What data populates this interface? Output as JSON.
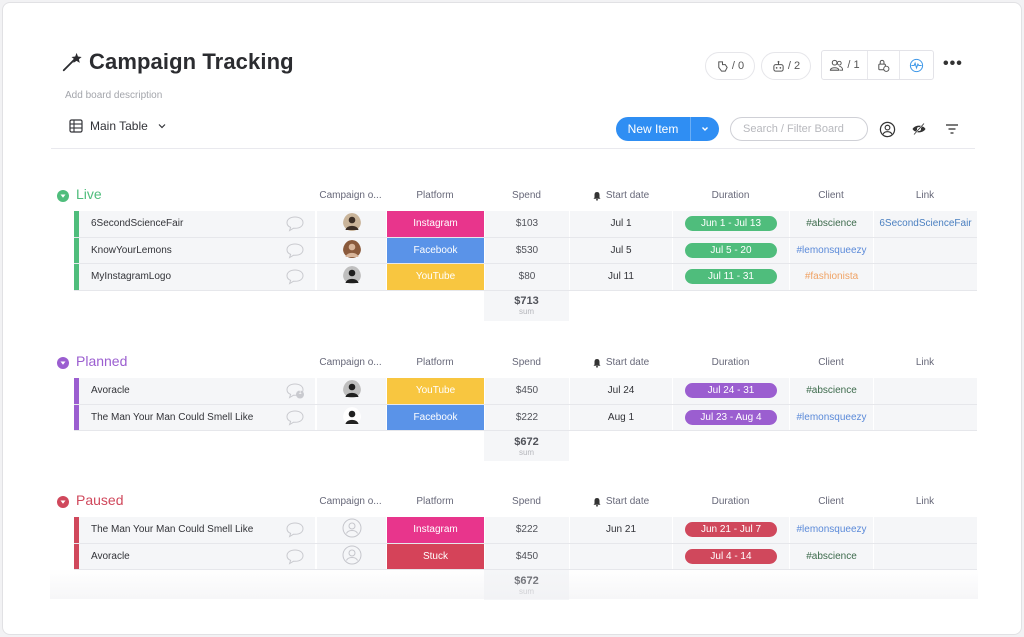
{
  "board": {
    "title": "Campaign Tracking",
    "description_placeholder": "Add board description",
    "view_name": "Main Table"
  },
  "header_tools": {
    "integrations_count": "/ 0",
    "automations_count": "/ 2",
    "members_count": "/ 1"
  },
  "toolbar": {
    "new_item_label": "New Item",
    "search_placeholder": "Search / Filter Board"
  },
  "columns": {
    "owner": "Campaign o...",
    "platform": "Platform",
    "spend": "Spend",
    "start": "Start date",
    "duration": "Duration",
    "client": "Client",
    "link": "Link"
  },
  "colors": {
    "accent": "#2f8ef3",
    "live": "#4fbd7c",
    "planned": "#9b5ed0",
    "paused": "#d0485c",
    "instagram": "#e8358c",
    "facebook": "#5a93e8",
    "youtube": "#f8c640",
    "stuck": "#d54359",
    "client_abscience": "#3d6b4c",
    "client_lemonsqueezy": "#5b8ad9",
    "client_fashionista": "#f0a365"
  },
  "groups": [
    {
      "name": "Live",
      "color": "#4fbd7c",
      "sum_value": "$713",
      "sum_label": "sum",
      "items": [
        {
          "name": "6SecondScienceFair",
          "comments": "",
          "owner": "pug",
          "platform": "Instagram",
          "platform_color": "#e8358c",
          "spend": "$103",
          "start": "Jul 1",
          "duration": "Jun 1 - Jul 13",
          "client": "#abscience",
          "client_color": "#3d6b4c",
          "link": "6SecondScienceFair"
        },
        {
          "name": "KnowYourLemons",
          "comments": "",
          "owner": "woman",
          "platform": "Facebook",
          "platform_color": "#5a93e8",
          "spend": "$530",
          "start": "Jul 5",
          "duration": "Jul 5 - 20",
          "client": "#lemonsqueezy",
          "client_color": "#5b8ad9",
          "link": ""
        },
        {
          "name": "MyInstagramLogo",
          "comments": "",
          "owner": "dark",
          "platform": "YouTube",
          "platform_color": "#f8c640",
          "spend": "$80",
          "start": "Jul 11",
          "duration": "Jul 11 - 31",
          "client": "#fashionista",
          "client_color": "#f0a365",
          "link": ""
        }
      ]
    },
    {
      "name": "Planned",
      "color": "#9b5ed0",
      "sum_value": "$672",
      "sum_label": "sum",
      "items": [
        {
          "name": "Avoracle",
          "comments": "1",
          "owner": "dark",
          "platform": "YouTube",
          "platform_color": "#f8c640",
          "spend": "$450",
          "start": "Jul 24",
          "duration": "Jul 24 - 31",
          "client": "#abscience",
          "client_color": "#3d6b4c",
          "link": ""
        },
        {
          "name": "The Man Your Man Could Smell Like",
          "comments": "",
          "owner": "man",
          "platform": "Facebook",
          "platform_color": "#5a93e8",
          "spend": "$222",
          "start": "Aug 1",
          "duration": "Jul 23 - Aug 4",
          "client": "#lemonsqueezy",
          "client_color": "#5b8ad9",
          "link": ""
        }
      ]
    },
    {
      "name": "Paused",
      "color": "#d0485c",
      "sum_value": "$672",
      "sum_label": "sum",
      "items": [
        {
          "name": "The Man Your Man Could Smell Like",
          "comments": "",
          "owner": "empty",
          "platform": "Instagram",
          "platform_color": "#e8358c",
          "spend": "$222",
          "start": "Jun 21",
          "duration": "Jun 21 - Jul 7",
          "client": "#lemonsqueezy",
          "client_color": "#5b8ad9",
          "link": ""
        },
        {
          "name": "Avoracle",
          "comments": "",
          "owner": "empty",
          "platform": "Stuck",
          "platform_color": "#d54359",
          "spend": "$450",
          "start": "",
          "duration": "Jul 4 - 14",
          "client": "#abscience",
          "client_color": "#3d6b4c",
          "link": ""
        }
      ]
    }
  ]
}
